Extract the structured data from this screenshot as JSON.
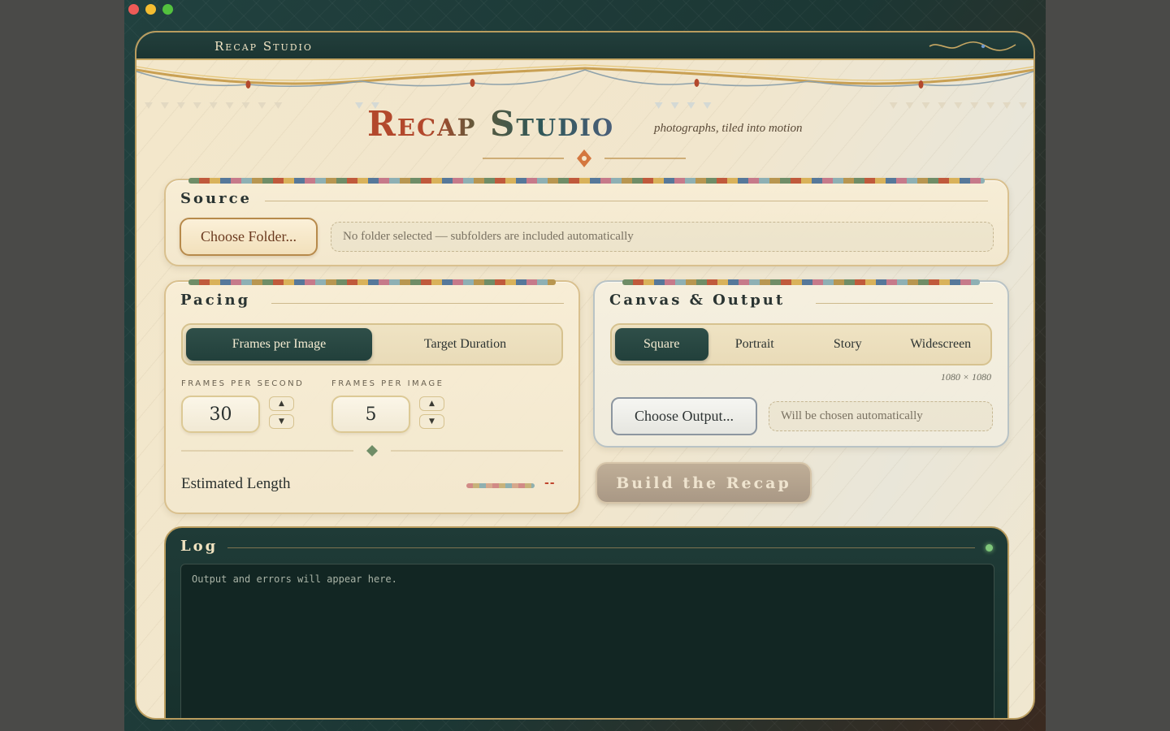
{
  "window": {
    "titlebar_name": "Recap Studio"
  },
  "hero": {
    "title": "Recap Studio",
    "tagline": "photographs, tiled into motion"
  },
  "source": {
    "heading": "Source",
    "choose_button": "Choose Folder...",
    "folder_placeholder": "No folder selected — subfolders are included automatically"
  },
  "pacing": {
    "heading": "Pacing",
    "modes": [
      {
        "label": "Frames per Image",
        "active": true
      },
      {
        "label": "Target Duration",
        "active": false
      }
    ],
    "fps_label": "FRAMES PER SECOND",
    "fps_value": "30",
    "fpi_label": "FRAMES PER IMAGE",
    "fpi_value": "5",
    "estimated_label": "Estimated Length",
    "estimated_value": "--"
  },
  "canvas": {
    "heading": "Canvas & Output",
    "formats": [
      {
        "label": "Square",
        "active": true
      },
      {
        "label": "Portrait",
        "active": false
      },
      {
        "label": "Story",
        "active": false
      },
      {
        "label": "Widescreen",
        "active": false
      }
    ],
    "size_note": "1080 × 1080",
    "choose_output_button": "Choose Output...",
    "output_placeholder": "Will be chosen automatically"
  },
  "build": {
    "label": "Build the Recap"
  },
  "log": {
    "heading": "Log",
    "placeholder": "Output and errors will appear here."
  },
  "colors": {
    "accent_dark_green": "#22403b",
    "accent_rust": "#b3482c",
    "gold_border": "#b99c5e"
  }
}
